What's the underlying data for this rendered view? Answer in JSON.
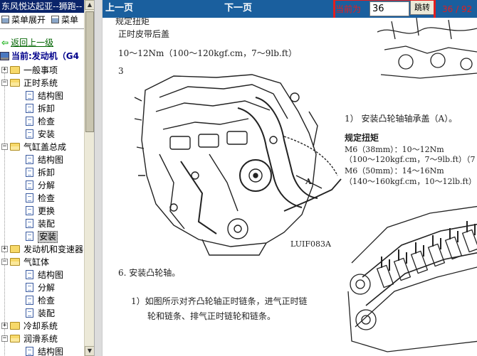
{
  "window_title": "东风悦达起亚--狮跑--",
  "menu": {
    "expand": "菜单展开",
    "collapse": "菜单"
  },
  "tree": {
    "back_link": "返回上一级",
    "current": "当前:发动机（G4",
    "items": [
      {
        "label": "一般事项",
        "type": "folder",
        "expanded": false
      },
      {
        "label": "正时系统",
        "type": "folder",
        "expanded": true,
        "children": [
          "结构图",
          "拆卸",
          "检查",
          "安装"
        ]
      },
      {
        "label": "气缸盖总成",
        "type": "folder",
        "expanded": true,
        "children": [
          "结构图",
          "拆卸",
          "分解",
          "检查",
          "更换",
          "装配",
          "安装"
        ]
      },
      {
        "label": "发动机和变速器",
        "type": "folder",
        "expanded": false
      },
      {
        "label": "气缸体",
        "type": "folder",
        "expanded": true,
        "children": [
          "结构图",
          "分解",
          "检查",
          "装配"
        ]
      },
      {
        "label": "冷却系统",
        "type": "folder",
        "expanded": false
      },
      {
        "label": "润滑系统",
        "type": "folder",
        "expanded": true,
        "children": [
          "结构图"
        ]
      }
    ],
    "selected": "安装"
  },
  "nav": {
    "prev": "上一页",
    "next": "下一页",
    "current_label": "当前为",
    "page_input_value": "36",
    "go_button": "跳转",
    "counter": "36 / 92"
  },
  "document": {
    "heading_torque": "规定扭矩",
    "left_line1": "正时皮带后盖",
    "left_line2": "10～12Nm（100～120kgf.cm，7～9lb.ft）",
    "step_number": "3",
    "figure_code": "LUIF083A",
    "figure_label_a": "A",
    "step6": "6.  安装凸轮轴。",
    "step6_1a": "1）如图所示对齐凸轮轴正时链条，进气正时链",
    "step6_1b": "轮和链条、排气正时链轮和链条。",
    "right_step1": "1）  安装凸轮轴轴承盖（A）。",
    "right_heading": "规定扭矩",
    "right_m6_38": "M6（38mm）：10～12Nm",
    "right_m6_38_b": "（100～120kgf.cm，7～9lb.ft）（7",
    "right_m6_50": "M6（50mm）：14～16Nm",
    "right_m6_50_b": "（140～160kgf.cm，10～12lb.ft）"
  },
  "colors": {
    "nav_bar": "#1a5f9e",
    "highlight_box": "#e41e1e",
    "tree_title_bar": "#0a246a"
  }
}
